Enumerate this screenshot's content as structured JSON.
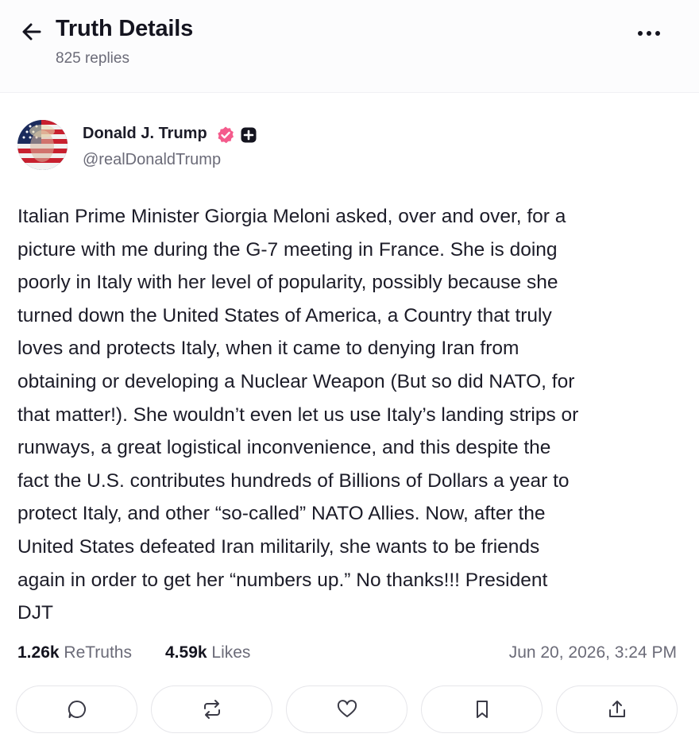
{
  "header": {
    "title": "Truth Details",
    "replies": "825 replies",
    "back_icon": "arrow-left-icon",
    "more_icon": "more-horizontal-icon"
  },
  "author": {
    "name": "Donald J. Trump",
    "handle": "@realDonaldTrump",
    "verified_color": "#f45b8c",
    "avatar": "american-flag-portrait"
  },
  "post": {
    "text": "Italian Prime Minister Giorgia Meloni asked, over and over, for a\npicture with me during the G-7 meeting in France. She is doing\npoorly in Italy with her level of popularity, possibly because she\nturned down the United States of America, a Country that truly\nloves and protects Italy, when it came to denying Iran from\nobtaining or developing a Nuclear Weapon (But so did NATO, for\nthat matter!). She wouldn’t even let us use Italy’s landing strips or\nrunways, a great logistical inconvenience, and this despite the\nfact the U.S. contributes hundreds of Billions of Dollars a year to\nprotect Italy, and other “so-called” NATO Allies. Now, after the\nUnited States defeated Iran militarily, she wants to be friends\nagain in order to get her “numbers up.” No thanks!!! President\nDJT"
  },
  "stats": {
    "retruths_count": "1.26k",
    "retruths_label": "ReTruths",
    "likes_count": "4.59k",
    "likes_label": "Likes",
    "timestamp": "Jun 20, 2026, 3:24 PM"
  },
  "actions": [
    {
      "icon": "reply-icon"
    },
    {
      "icon": "retruth-icon"
    },
    {
      "icon": "heart-icon"
    },
    {
      "icon": "bookmark-icon"
    },
    {
      "icon": "share-icon"
    }
  ]
}
